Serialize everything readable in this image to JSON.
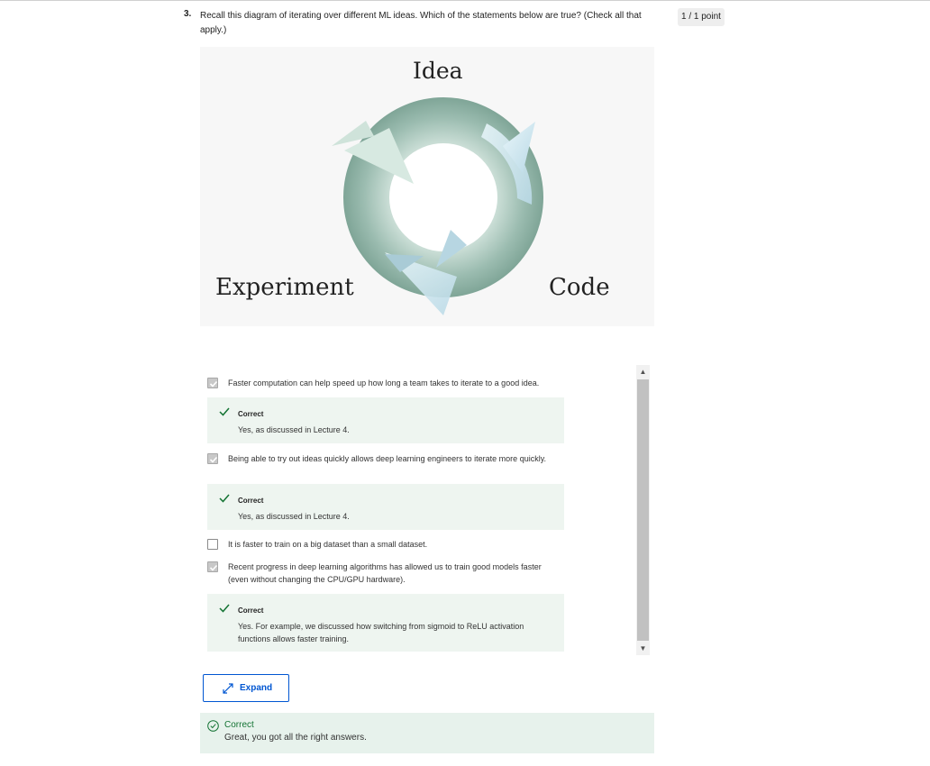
{
  "question": {
    "number": "3.",
    "text": "Recall this diagram of iterating over different ML ideas. Which of the statements below are true? (Check all that apply.)",
    "points": "1 / 1 point"
  },
  "diagram": {
    "labels": {
      "idea": "Idea",
      "experiment": "Experiment",
      "code": "Code"
    }
  },
  "options": [
    {
      "text": "Faster computation can help speed up how long a team takes to iterate to a good idea.",
      "checked": true,
      "feedback": {
        "title": "Correct",
        "text": "Yes, as discussed in Lecture 4."
      }
    },
    {
      "text": "Being able to try out ideas quickly allows deep learning engineers to iterate more quickly.",
      "checked": true,
      "feedback": {
        "title": "Correct",
        "text": "Yes, as discussed in Lecture 4."
      }
    },
    {
      "text": "It is faster to train on a big dataset than a small dataset.",
      "checked": false
    },
    {
      "text": "Recent progress in deep learning algorithms has allowed us to train good models faster (even without changing the CPU/GPU hardware).",
      "checked": true,
      "feedback": {
        "title": "Correct",
        "text": "Yes. For example, we discussed how switching from sigmoid to ReLU activation functions allows faster training."
      }
    }
  ],
  "expand_button": {
    "label": "Expand",
    "icon": "expand-arrows-icon"
  },
  "result": {
    "title": "Correct",
    "text": "Great, you got all the right answers.",
    "icon": "check-circle-icon"
  },
  "colors": {
    "accent": "#0056d2",
    "correct_green": "#137333",
    "feedback_bg": "#eef5f0",
    "result_bg": "#e7f2ec"
  }
}
